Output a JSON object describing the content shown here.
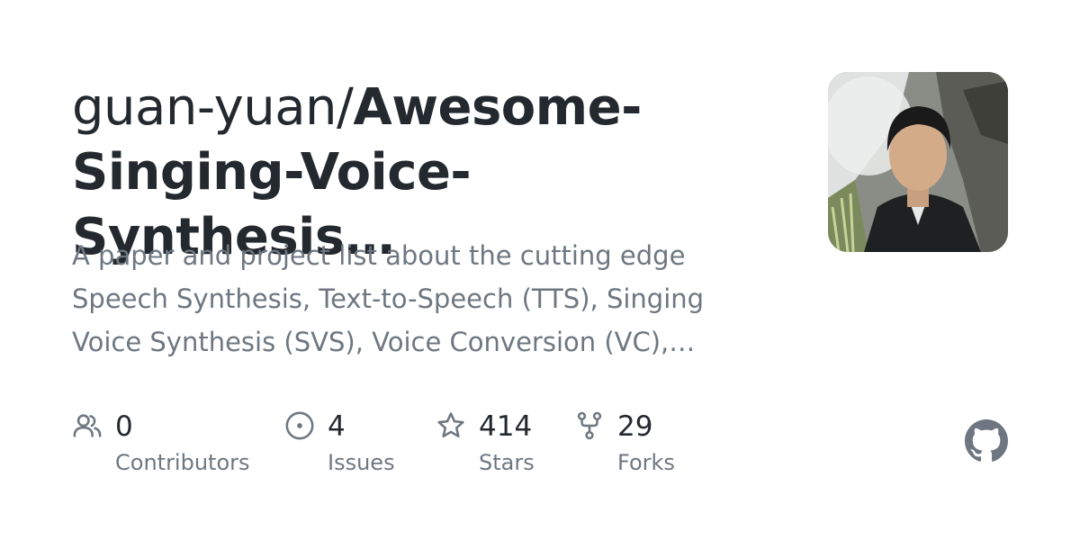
{
  "repo": {
    "owner": "guan-yuan/",
    "name_line1": "Awesome-",
    "name_line2": "Singing-Voice-Synthesis…",
    "description_line1": "A paper and project list about the cutting edge",
    "description_line2": "Speech Synthesis, Text-to-Speech (TTS), Singing",
    "description_line3": "Voice Synthesis (SVS), Voice Conversion (VC),…"
  },
  "stats": {
    "contributors": {
      "value": "0",
      "label": "Contributors",
      "icon": "people-icon"
    },
    "issues": {
      "value": "4",
      "label": "Issues",
      "icon": "issue-opened-icon"
    },
    "stars": {
      "value": "414",
      "label": "Stars",
      "icon": "star-icon"
    },
    "forks": {
      "value": "29",
      "label": "Forks",
      "icon": "repo-forked-icon"
    }
  },
  "icons": {
    "avatar": "owner-avatar-photo",
    "brand": "github-mark-icon"
  },
  "colors": {
    "title": "#24292f",
    "muted": "#6e7781",
    "icon": "#6e7781"
  }
}
